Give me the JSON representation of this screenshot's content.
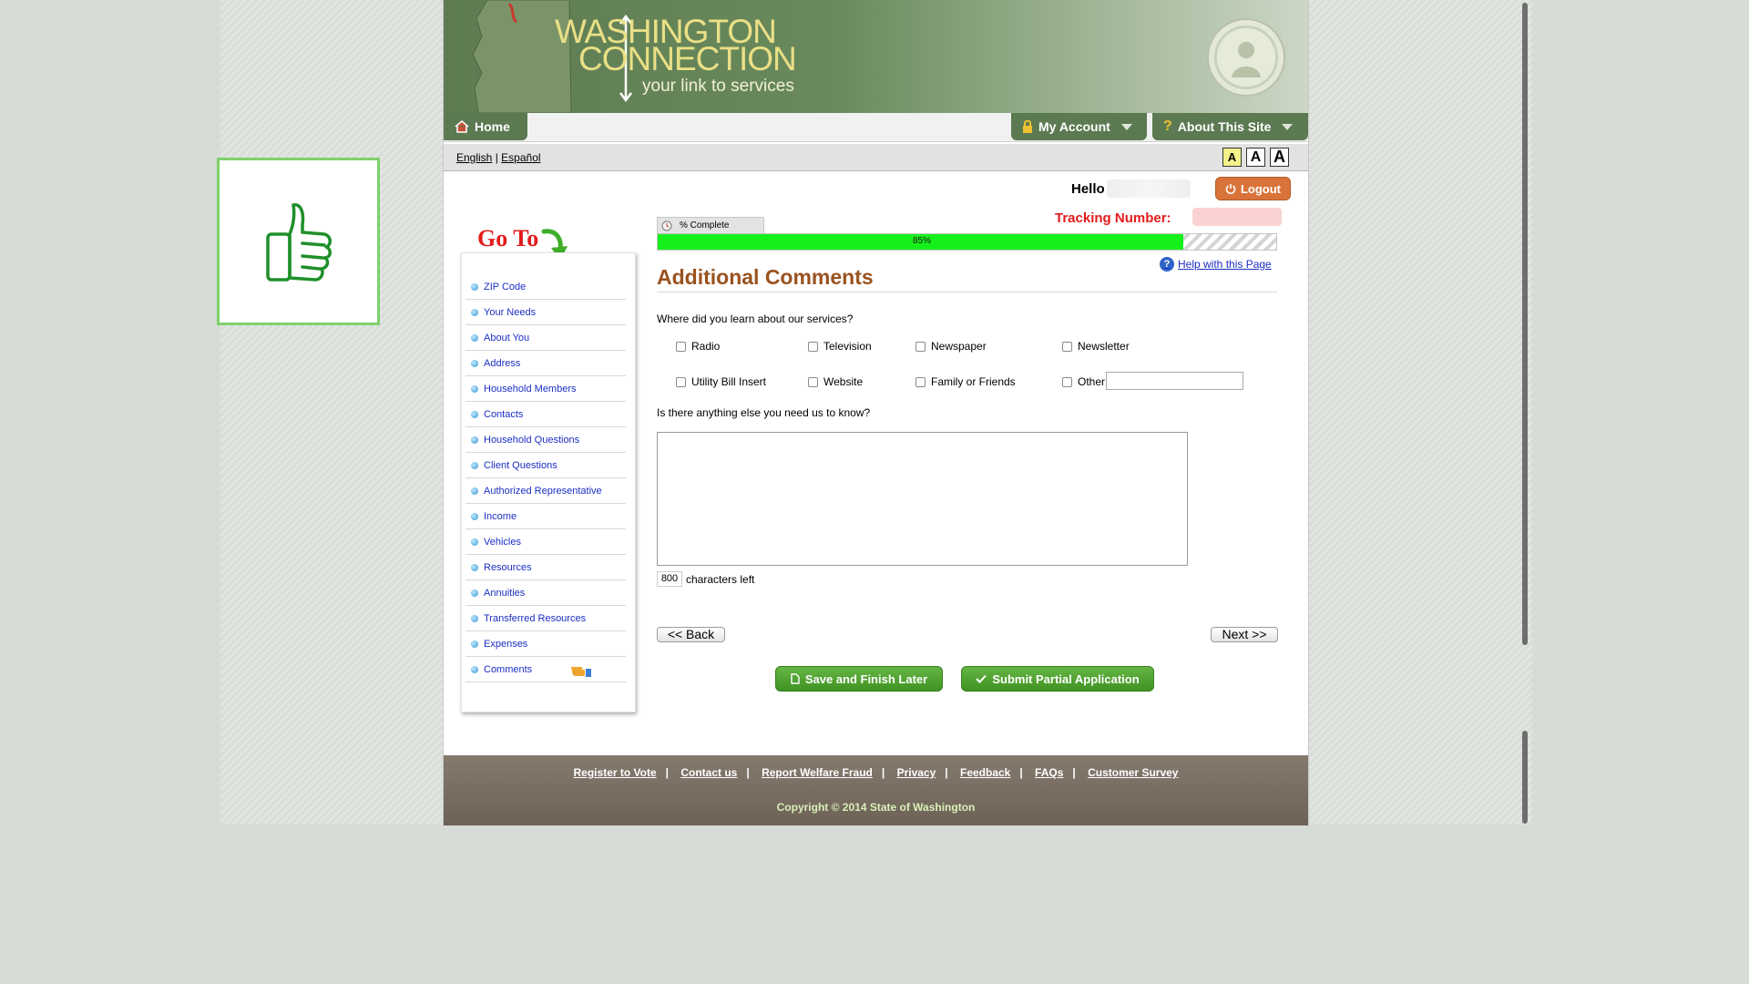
{
  "header": {
    "logo_line1": "WASHINGTON",
    "logo_line2": "CONNECTION",
    "tagline": "your link to services"
  },
  "nav": {
    "home": "Home",
    "my_account": "My Account",
    "about": "About This Site"
  },
  "lang": {
    "english": "English",
    "separator": "|",
    "spanish": "Español"
  },
  "font_sizes": [
    "A",
    "A",
    "A"
  ],
  "user": {
    "hello": "Hello",
    "logout": "Logout",
    "tracking_label": "Tracking Number:"
  },
  "progress": {
    "tab_label": "% Complete",
    "percent": 85,
    "percent_text": "85%"
  },
  "sidebar": {
    "goto": "Go To",
    "items": [
      {
        "label": "ZIP Code"
      },
      {
        "label": "Your Needs"
      },
      {
        "label": "About You"
      },
      {
        "label": "Address"
      },
      {
        "label": "Household Members"
      },
      {
        "label": "Contacts"
      },
      {
        "label": "Household Questions"
      },
      {
        "label": "Client Questions"
      },
      {
        "label": "Authorized Representative"
      },
      {
        "label": "Income"
      },
      {
        "label": "Vehicles"
      },
      {
        "label": "Resources"
      },
      {
        "label": "Annuities"
      },
      {
        "label": "Transferred Resources"
      },
      {
        "label": "Expenses"
      },
      {
        "label": "Comments"
      }
    ]
  },
  "main": {
    "help_link": "Help with this Page",
    "title": "Additional Comments",
    "question1": "Where did you learn about our services?",
    "options": [
      "Radio",
      "Television",
      "Newspaper",
      "Newsletter",
      "Utility Bill Insert",
      "Website",
      "Family or Friends",
      "Other"
    ],
    "question2": "Is there anything else you need us to know?",
    "char_count": "800",
    "char_label": "characters left",
    "back": "<< Back",
    "next": "Next >>",
    "save_later": "Save and Finish Later",
    "submit_partial": "Submit Partial Application"
  },
  "footer": {
    "links": [
      "Register to Vote",
      "Contact us",
      "Report Welfare Fraud",
      "Privacy",
      "Feedback",
      "FAQs",
      "Customer Survey"
    ],
    "copyright": "Copyright © 2014 State of Washington"
  },
  "colors": {
    "header_green": "#5e7b52",
    "progress_green": "#16f01a",
    "title_brown": "#9a521f",
    "tracking_red": "#e31b1b",
    "link_blue": "#1b2ec4",
    "button_green": "#4aa02c",
    "logout_orange": "#d9733a",
    "footer_brown": "#7a6e63"
  }
}
